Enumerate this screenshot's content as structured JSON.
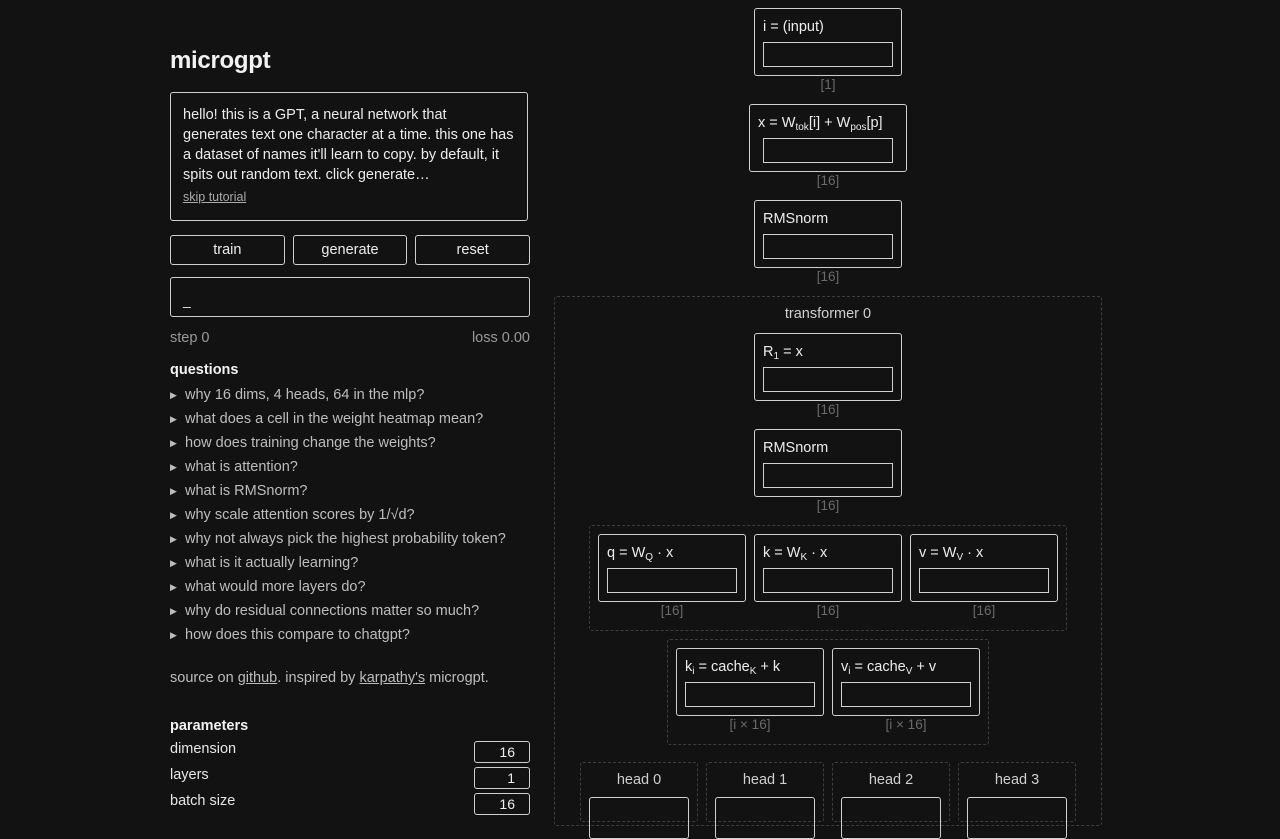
{
  "app": {
    "title": "microgpt"
  },
  "intro": {
    "text": "hello! this is a GPT, a neural network that generates text one character at a time. this one has a dataset of names it'll learn to copy. by default, it spits out random text. click generate…",
    "skip_label": "skip tutorial"
  },
  "controls": {
    "train_label": "train",
    "generate_label": "generate",
    "reset_label": "reset"
  },
  "output": {
    "text": "_"
  },
  "status": {
    "step": "step 0",
    "loss": "loss 0.00"
  },
  "questions": {
    "title": "questions",
    "items": [
      "why 16 dims, 4 heads, 64 in the mlp?",
      "what does a cell in the weight heatmap mean?",
      "how does training change the weights?",
      "what is attention?",
      "what is RMSnorm?",
      "why scale attention scores by 1/√d?",
      "why not always pick the highest probability token?",
      "what is it actually learning?",
      "what would more layers do?",
      "why do residual connections matter so much?",
      "how does this compare to chatgpt?"
    ]
  },
  "source": {
    "prefix": "source on ",
    "github_label": "github",
    "middle": ". inspired by ",
    "karpathy_label": "karpathy's",
    "suffix": " microgpt."
  },
  "parameters": {
    "title": "parameters",
    "items": [
      {
        "label": "dimension",
        "value": "16"
      },
      {
        "label": "layers",
        "value": "1"
      },
      {
        "label": "batch size",
        "value": "16"
      }
    ]
  },
  "diagram": {
    "input_node": {
      "label": "i = (input)",
      "dim": "[1]"
    },
    "embed_node": {
      "label_x": "x = W",
      "sub_tok": "tok",
      "label_i": "[i] + W",
      "sub_pos": "pos",
      "label_p": "[p]",
      "dim": "[16]"
    },
    "rmsnorm_1": {
      "label": "RMSnorm",
      "dim": "[16]"
    },
    "transformer": {
      "title": "transformer 0",
      "residual": {
        "label_r": "R",
        "sub": "1",
        "label_eq": " = x",
        "dim": "[16]"
      },
      "rmsnorm": {
        "label": "RMSnorm",
        "dim": "[16]"
      },
      "q": {
        "label": "q = W",
        "sub": "Q",
        "suffix": " · x",
        "dim": "[16]"
      },
      "k": {
        "label": "k = W",
        "sub": "K",
        "suffix": " · x",
        "dim": "[16]"
      },
      "v": {
        "label": "v = W",
        "sub": "V",
        "suffix": " · x",
        "dim": "[16]"
      },
      "kcache": {
        "label": "k",
        "sub": "i",
        "mid": " = cache",
        "sub2": "K",
        "suffix": " + k",
        "dim": "[i × 16]"
      },
      "vcache": {
        "label": "v",
        "sub": "i",
        "mid": " = cache",
        "sub2": "V",
        "suffix": " + v",
        "dim": "[i × 16]"
      },
      "heads": [
        "head 0",
        "head 1",
        "head 2",
        "head 3"
      ]
    }
  }
}
